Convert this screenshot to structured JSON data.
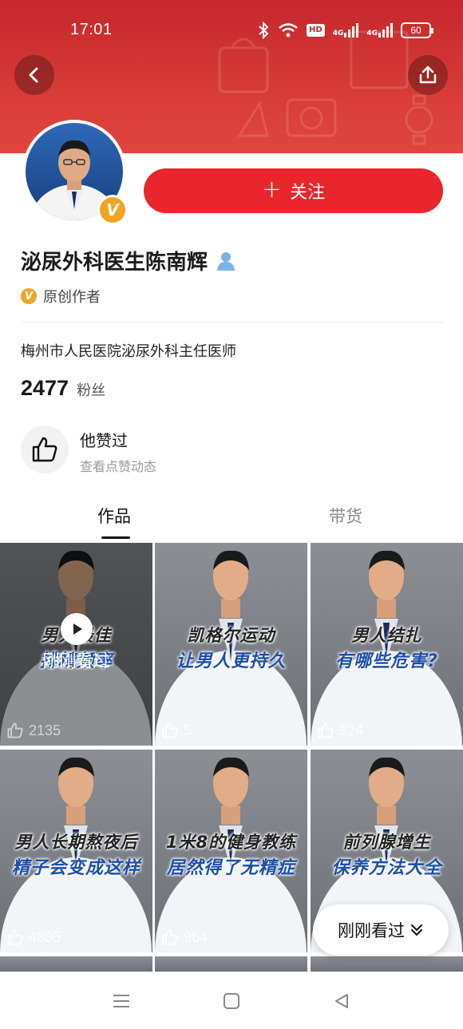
{
  "status_bar": {
    "time": "17:01",
    "icons": [
      "bluetooth-icon",
      "wifi-icon",
      "hd-icon",
      "signal-4g-icon",
      "signal-4g-icon"
    ],
    "hd_label": "HD",
    "network_1": "4G",
    "network_2": "4G",
    "battery": "60"
  },
  "header": {
    "back_icon": "chevron-left-icon",
    "share_icon": "share-icon",
    "banner_color": "#d13431"
  },
  "profile": {
    "name": "泌尿外科医生陈南辉",
    "verified_badge": "V",
    "follow_label": "关注",
    "origin_badge": "V",
    "origin_label": "原创作者",
    "bio": "梅州市人民医院泌尿外科主任医师",
    "fans_count": "2477",
    "fans_label": "粉丝"
  },
  "liked": {
    "title": "他赞过",
    "subtitle": "查看点赞动态"
  },
  "tabs": [
    {
      "label": "作品",
      "active": true
    },
    {
      "label": "带货",
      "active": false
    }
  ],
  "videos": [
    {
      "cap1": "男人最佳",
      "cap2": "排精频率",
      "likes": "2135",
      "watched": true
    },
    {
      "cap1": "凯格尔运动",
      "cap2": "让男人更持久",
      "likes": "5",
      "watched": false
    },
    {
      "cap1": "男人结扎",
      "cap2": "有哪些危害?",
      "likes": "324",
      "watched": false
    },
    {
      "cap1": "男人长期熬夜后",
      "cap2": "精子会变成这样",
      "likes": "4805",
      "watched": false
    },
    {
      "cap1": "1米8的健身教练",
      "cap2": "居然得了无精症",
      "likes": "964",
      "watched": false
    },
    {
      "cap1": "前列腺增生",
      "cap2": "保养方法大全",
      "likes": "",
      "watched": false
    }
  ],
  "watched_overlay_label": "刚刚看过",
  "recent_pill_label": "刚刚看过",
  "accent_color": "#e8262c",
  "caption_blue": "#1d4fa8"
}
